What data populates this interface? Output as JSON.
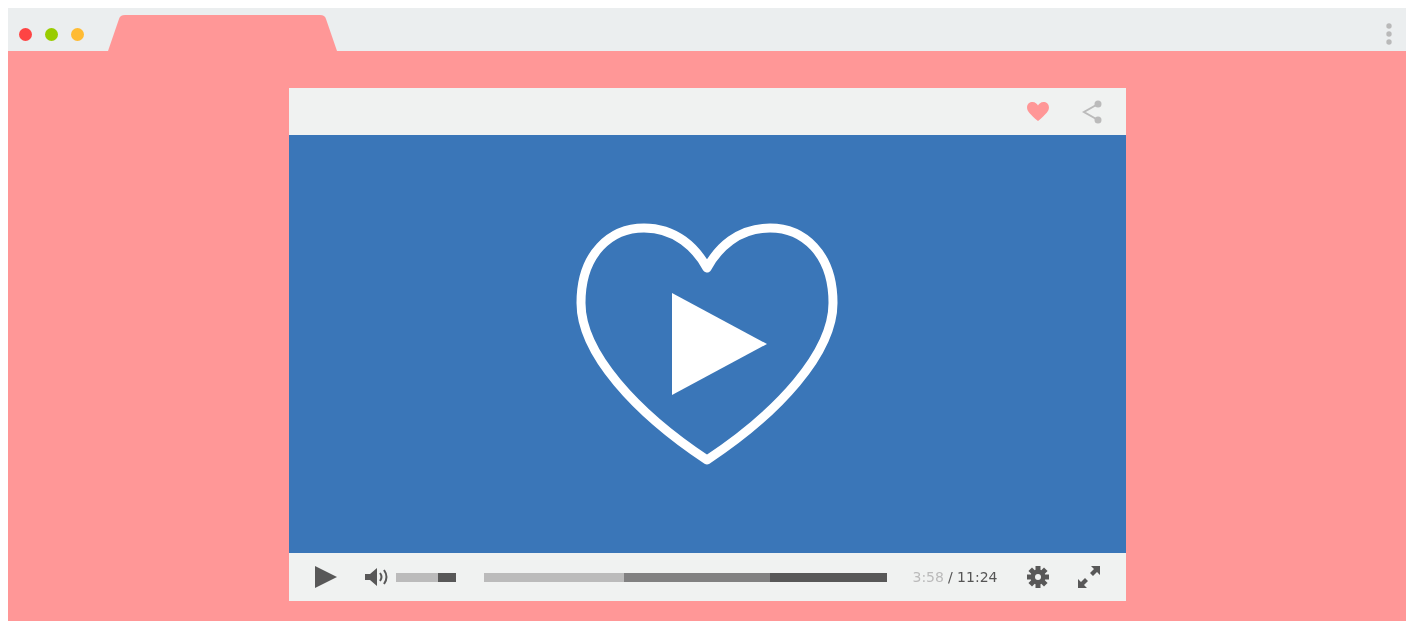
{
  "player": {
    "liked": true,
    "volume": {
      "level": 0.7
    },
    "progress": {
      "level": 0.348
    },
    "buffer": {
      "level": 0.71
    },
    "current_time": "3:58",
    "duration": "/ 11:24"
  }
}
